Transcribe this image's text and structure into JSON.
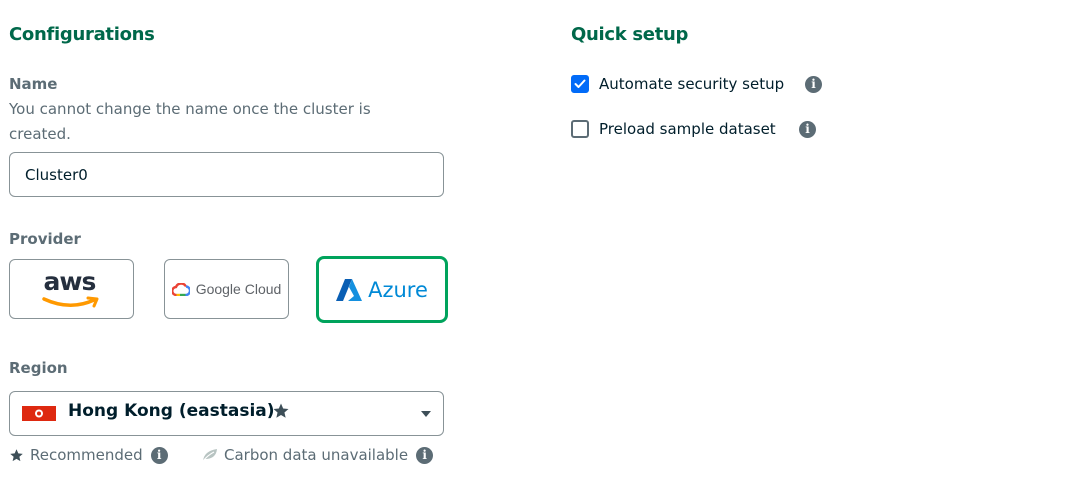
{
  "configurations": {
    "heading": "Configurations",
    "name": {
      "label": "Name",
      "description_line1": "You cannot change the name once the cluster is",
      "description_line2": "created.",
      "value": "Cluster0"
    },
    "provider": {
      "label": "Provider",
      "options": [
        {
          "id": "aws",
          "label": "aws",
          "selected": false
        },
        {
          "id": "gcp",
          "label": "Google Cloud",
          "selected": false
        },
        {
          "id": "azure",
          "label": "Azure",
          "selected": true
        }
      ]
    },
    "region": {
      "label": "Region",
      "selected": "Hong Kong (eastasia)",
      "flag": "hong-kong-flag",
      "recommended": true
    },
    "legend": {
      "recommended": "Recommended",
      "carbon": "Carbon data unavailable"
    }
  },
  "quick_setup": {
    "heading": "Quick setup",
    "options": [
      {
        "label": "Automate security setup",
        "checked": true
      },
      {
        "label": "Preload sample dataset",
        "checked": false
      }
    ]
  },
  "colors": {
    "heading_green": "#00684a",
    "selected_border": "#00a35c",
    "checkbox_blue": "#016bf8",
    "hk_flag_red": "#de2910"
  }
}
